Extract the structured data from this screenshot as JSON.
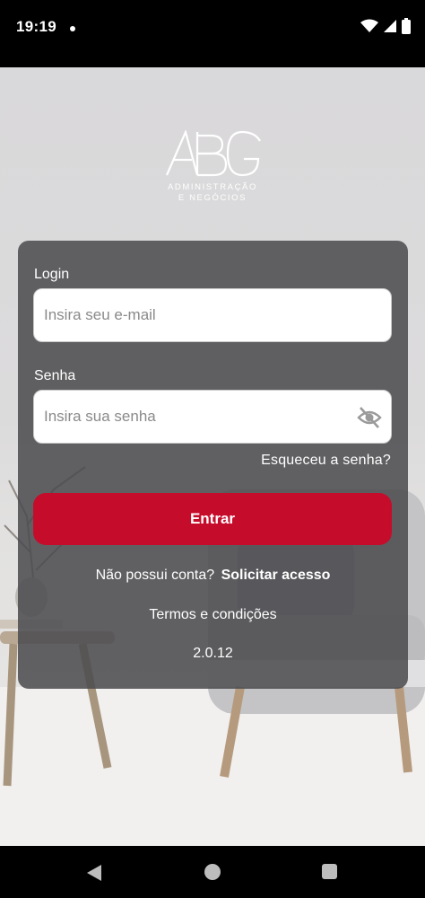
{
  "status_bar": {
    "time": "19:19"
  },
  "brand": {
    "logo_mark": "ABG",
    "tagline_line1": "ADMINISTRAÇÃO",
    "tagline_line2": "E NEGÓCIOS"
  },
  "login_form": {
    "login_label": "Login",
    "email_placeholder": "Insira seu e-mail",
    "password_label": "Senha",
    "password_placeholder": "Insira sua senha",
    "forgot_password": "Esqueceu a senha?",
    "submit_label": "Entrar",
    "no_account_text": "Não possui conta?",
    "request_access_link": "Solicitar acesso",
    "terms_link": "Termos e condições",
    "version": "2.0.12"
  },
  "icons": {
    "password_toggle": "eye-off-icon",
    "wifi": "wifi-icon",
    "signal": "signal-icon",
    "battery": "battery-icon"
  },
  "colors": {
    "primary_button": "#c60c2b",
    "card_background": "#4b4a4e",
    "text_on_card": "#ffffff"
  }
}
